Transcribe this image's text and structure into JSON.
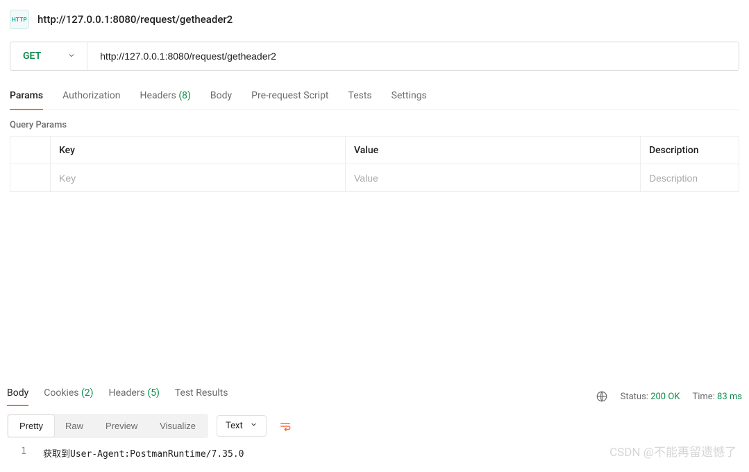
{
  "header": {
    "badge_text": "HTTP",
    "title": "http://127.0.0.1:8080/request/getheader2"
  },
  "request": {
    "method": "GET",
    "url": "http://127.0.0.1:8080/request/getheader2"
  },
  "tabs": {
    "params": "Params",
    "authorization": "Authorization",
    "headers": "Headers",
    "headers_count": "(8)",
    "body": "Body",
    "prerequest": "Pre-request Script",
    "tests": "Tests",
    "settings": "Settings"
  },
  "params_section": {
    "label": "Query Params",
    "columns": {
      "key": "Key",
      "value": "Value",
      "description": "Description"
    },
    "placeholders": {
      "key": "Key",
      "value": "Value",
      "description": "Description"
    }
  },
  "response": {
    "tabs": {
      "body": "Body",
      "cookies": "Cookies",
      "cookies_count": "(2)",
      "headers": "Headers",
      "headers_count": "(5)",
      "test_results": "Test Results"
    },
    "status_label": "Status:",
    "status_value": "200 OK",
    "time_label": "Time:",
    "time_value": "83 ms",
    "views": {
      "pretty": "Pretty",
      "raw": "Raw",
      "preview": "Preview",
      "visualize": "Visualize"
    },
    "format": "Text",
    "body_line_no": "1",
    "body_text": "获取到User-Agent:PostmanRuntime/7.35.0"
  },
  "watermark": "CSDN @不能再留遗憾了"
}
